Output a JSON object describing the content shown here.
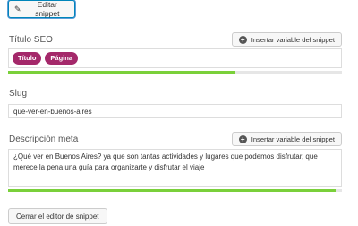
{
  "edit_snippet_button": {
    "label": "Editar snippet",
    "icon": "pencil-icon"
  },
  "seo_title": {
    "label": "Título SEO",
    "insert_variable_label": "Insertar variable del snippet",
    "tags": [
      "Título",
      "Página"
    ],
    "progress_percent": 68,
    "progress_color": "#7ad03a"
  },
  "slug": {
    "label": "Slug",
    "value": "que-ver-en-buenos-aires"
  },
  "meta_description": {
    "label": "Descripción meta",
    "insert_variable_label": "Insertar variable del snippet",
    "value": "¿Qué ver en Buenos Aires? ya que son tantas actividades y lugares que podemos disfrutar, que merece la pena una guía para organizarte y disfrutar el viaje",
    "progress_percent": 98,
    "progress_color": "#7ad03a"
  },
  "close_editor_button": {
    "label": "Cerrar el editor de snippet"
  },
  "colors": {
    "tag_bg": "#a4286a",
    "focus_border": "#0085ba"
  }
}
